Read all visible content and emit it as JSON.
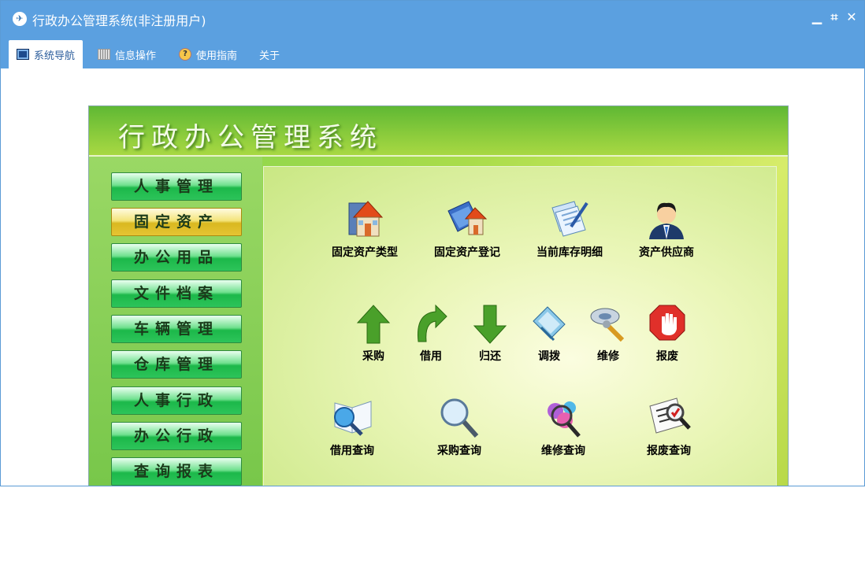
{
  "window": {
    "title": "行政办公管理系统(非注册用户)",
    "controls": {
      "minimize": "▁",
      "restore": "⌗",
      "close": "✕"
    }
  },
  "menu": {
    "tabs": [
      {
        "label": "系统导航",
        "icon": "monitor-icon",
        "active": true
      },
      {
        "label": "信息操作",
        "icon": "grid-icon",
        "active": false
      },
      {
        "label": "使用指南",
        "icon": "help-icon",
        "active": false
      },
      {
        "label": "关于",
        "icon": "",
        "active": false
      }
    ]
  },
  "banner": {
    "title": "行政办公管理系统"
  },
  "sidebar": {
    "items": [
      {
        "label": "人事管理",
        "active": false
      },
      {
        "label": "固定资产",
        "active": true
      },
      {
        "label": "办公用品",
        "active": false
      },
      {
        "label": "文件档案",
        "active": false
      },
      {
        "label": "车辆管理",
        "active": false
      },
      {
        "label": "仓库管理",
        "active": false
      },
      {
        "label": "人事行政",
        "active": false
      },
      {
        "label": "办公行政",
        "active": false
      },
      {
        "label": "查询报表",
        "active": false
      }
    ]
  },
  "content": {
    "row1": [
      {
        "label": "固定资产类型",
        "icon": "house-book-icon"
      },
      {
        "label": "固定资产登记",
        "icon": "house-folder-icon"
      },
      {
        "label": "当前库存明细",
        "icon": "documents-pen-icon"
      },
      {
        "label": "资产供应商",
        "icon": "person-icon"
      }
    ],
    "row2": [
      {
        "label": "采购",
        "icon": "arrow-up-icon"
      },
      {
        "label": "借用",
        "icon": "curved-arrow-icon"
      },
      {
        "label": "归还",
        "icon": "arrow-down-icon"
      },
      {
        "label": "调拨",
        "icon": "transfer-icon"
      },
      {
        "label": "维修",
        "icon": "wrench-icon"
      },
      {
        "label": "报废",
        "icon": "stop-hand-icon"
      }
    ],
    "row3": [
      {
        "label": "借用查询",
        "icon": "book-magnifier-icon"
      },
      {
        "label": "采购查询",
        "icon": "magnifier-icon"
      },
      {
        "label": "维修查询",
        "icon": "gears-magnifier-icon"
      },
      {
        "label": "报废查询",
        "icon": "list-magnifier-icon"
      }
    ]
  },
  "colors": {
    "titlebar": "#5ba0e0",
    "banner": "#5fb834",
    "nav_button": "#1cb84a",
    "nav_active": "#d9b820"
  }
}
